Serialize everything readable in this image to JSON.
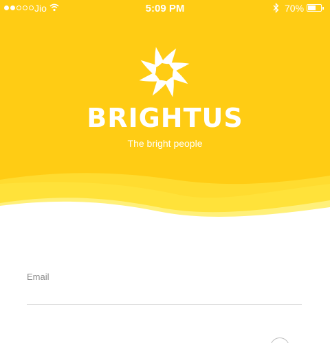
{
  "status_bar": {
    "carrier": "Jio",
    "time": "5:09 PM",
    "battery_percent": "70%",
    "battery_level": 0.7,
    "signal_bars_filled": 2,
    "signal_bars_total": 5
  },
  "brand": {
    "name": "BRIGHTUS",
    "tagline": "The bright people",
    "primary_color": "#FFCC14",
    "wave_color": "#FFE23A"
  },
  "form": {
    "email_label": "Email",
    "email_value": "",
    "password_label": "",
    "password_value": ""
  },
  "icons": {
    "logo": "sun-swirl-logo-icon",
    "wifi": "wifi-icon",
    "bluetooth": "bluetooth-icon",
    "battery": "battery-icon",
    "password_toggle": "eye-icon"
  }
}
